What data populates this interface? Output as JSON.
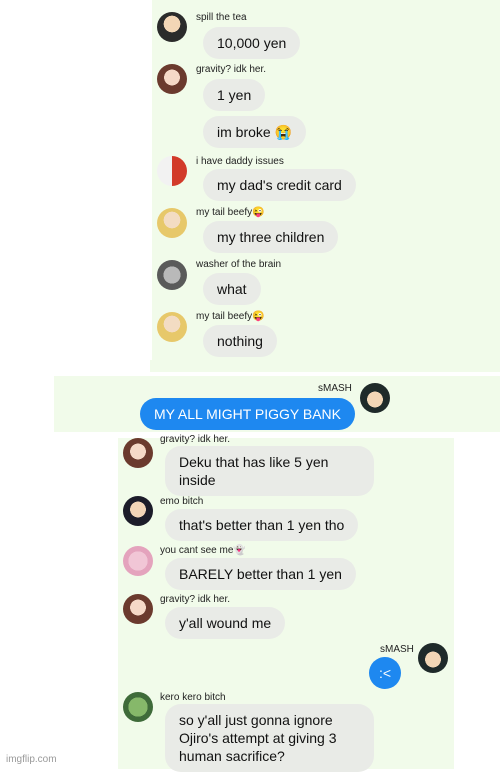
{
  "messages_top": [
    {
      "sender": "spill the tea",
      "text": "10,000 yen"
    },
    {
      "sender": "gravity? idk her.",
      "text": "1 yen"
    },
    {
      "sender": "",
      "text": "im broke 😭"
    },
    {
      "sender": "i have daddy issues",
      "text": "my dad's credit card"
    },
    {
      "sender": "my tail beefy😜",
      "text": "my three children"
    },
    {
      "sender": "washer of the brain",
      "text": "what"
    },
    {
      "sender": "my tail beefy😜",
      "text": "nothing"
    }
  ],
  "middle": {
    "sender": "sMASH",
    "text": "MY ALL MIGHT PIGGY BANK"
  },
  "messages_bottom": [
    {
      "sender": "gravity? idk her.",
      "text": "Deku that has like 5 yen inside"
    },
    {
      "sender": "emo bitch",
      "text": "that's better than 1 yen tho"
    },
    {
      "sender": "you cant see me👻",
      "text": "BARELY better than 1 yen"
    },
    {
      "sender": "gravity? idk her.",
      "text": "y'all wound me"
    },
    {
      "sender": "sMASH",
      "text": ":<"
    },
    {
      "sender": "kero kero bitch",
      "text": "so y'all just gonna ignore Ojiro's attempt at giving 3 human sacrifice?"
    }
  ],
  "watermark": "imgflip.com",
  "colors": {
    "panel": "#f1fbea",
    "bubble": "#e9ebe7",
    "blue_bubble": "#1e88f0"
  }
}
